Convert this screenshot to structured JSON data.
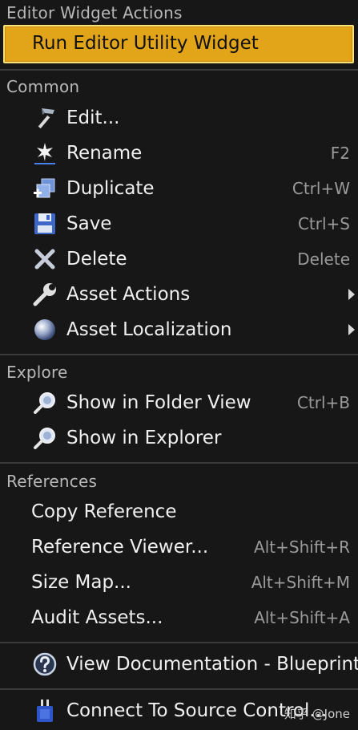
{
  "menu": {
    "header": "Editor Widget Actions",
    "primary_action": "Run Editor Utility Widget",
    "sections": {
      "common": {
        "title": "Common",
        "items": [
          {
            "label": "Edit...",
            "shortcut": "",
            "icon": "hammer-icon"
          },
          {
            "label": "Rename",
            "shortcut": "F2",
            "icon": "rename-star-icon"
          },
          {
            "label": "Duplicate",
            "shortcut": "Ctrl+W",
            "icon": "duplicate-icon"
          },
          {
            "label": "Save",
            "shortcut": "Ctrl+S",
            "icon": "save-disk-icon"
          },
          {
            "label": "Delete",
            "shortcut": "Delete",
            "icon": "delete-x-icon"
          },
          {
            "label": "Asset Actions",
            "shortcut": "",
            "icon": "wrench-icon",
            "submenu": true
          },
          {
            "label": "Asset Localization",
            "shortcut": "",
            "icon": "globe-icon",
            "submenu": true
          }
        ]
      },
      "explore": {
        "title": "Explore",
        "items": [
          {
            "label": "Show in Folder View",
            "shortcut": "Ctrl+B",
            "icon": "magnifier-icon"
          },
          {
            "label": "Show in Explorer",
            "shortcut": "",
            "icon": "magnifier-icon"
          }
        ]
      },
      "references": {
        "title": "References",
        "items": [
          {
            "label": "Copy Reference",
            "shortcut": ""
          },
          {
            "label": "Reference Viewer...",
            "shortcut": "Alt+Shift+R"
          },
          {
            "label": "Size Map...",
            "shortcut": "Alt+Shift+M"
          },
          {
            "label": "Audit Assets...",
            "shortcut": "Alt+Shift+A"
          }
        ]
      }
    },
    "documentation": {
      "label": "View Documentation - Blueprint",
      "icon": "help-icon"
    },
    "source_control": {
      "label": "Connect To Source Control...",
      "icon": "source-control-plug-icon"
    }
  },
  "watermark": "知乎 @Jone",
  "colors": {
    "background": "#171717",
    "highlight": "#e2a51a",
    "highlight_border": "#f6e27a",
    "text": "#f0f0f0",
    "shortcut": "#9a9a9a"
  }
}
